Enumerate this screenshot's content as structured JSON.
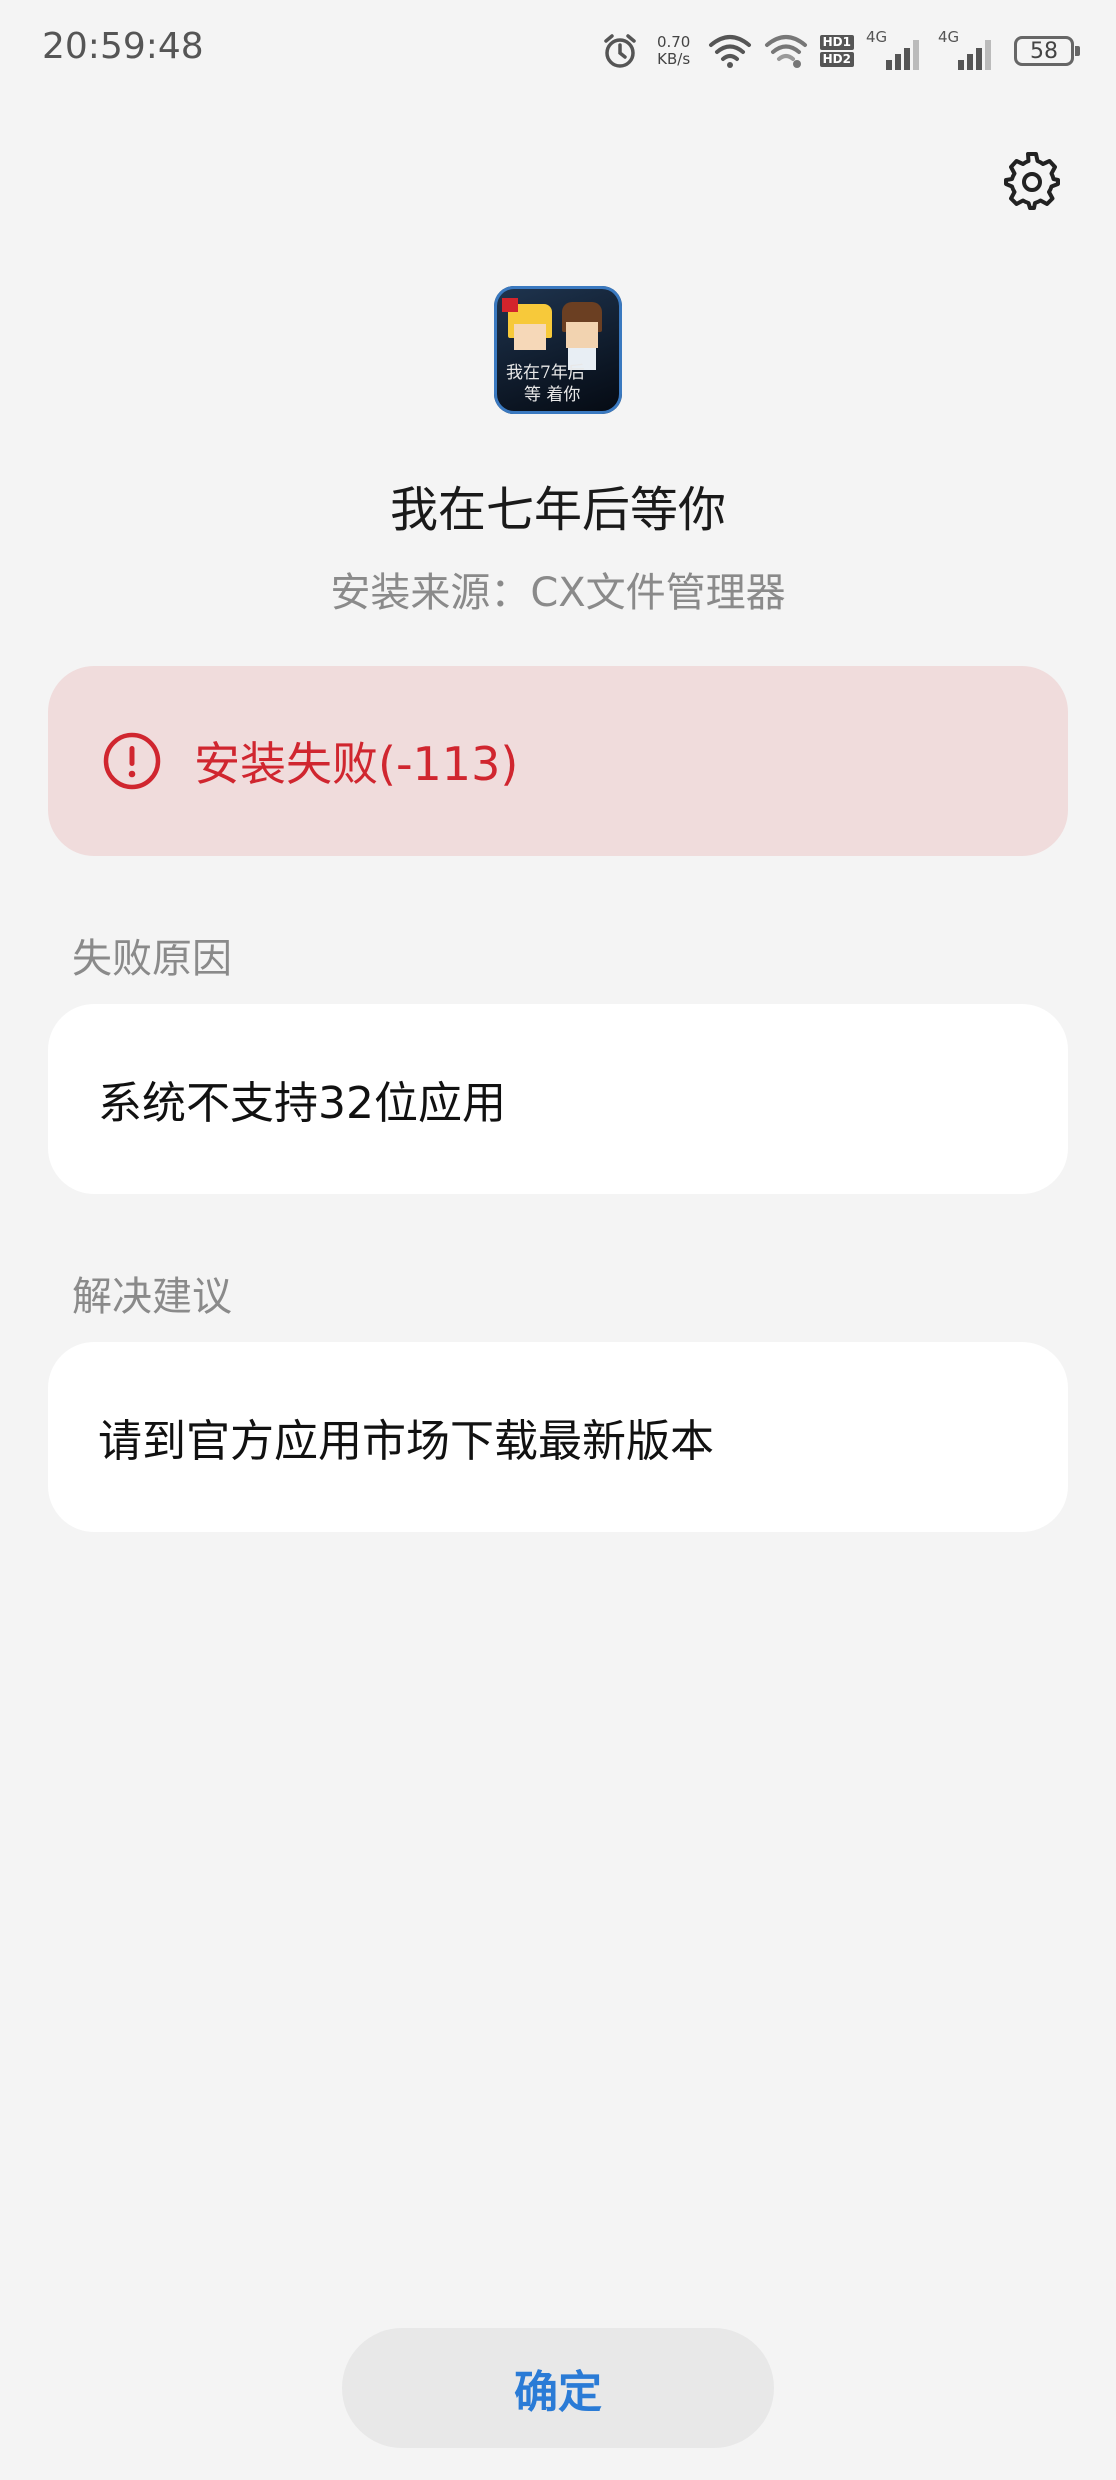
{
  "status_bar": {
    "time": "20:59:48",
    "net_speed_value": "0.70",
    "net_speed_unit": "KB/s",
    "hd1": "HD1",
    "hd2": "HD2",
    "sim1_tag": "4G",
    "sim2_tag": "4G",
    "battery": "58"
  },
  "header": {
    "settings_icon": "gear-icon"
  },
  "app": {
    "icon_text_line1": "我在7年后",
    "icon_text_line2": "等 着你",
    "name": "我在七年后等你",
    "install_source": "安装来源：CX文件管理器"
  },
  "error": {
    "icon": "alert-circle-icon",
    "message": "安装失败(-113)",
    "color": "#d0262f"
  },
  "failure_reason": {
    "label": "失败原因",
    "text": "系统不支持32位应用"
  },
  "suggestion": {
    "label": "解决建议",
    "text": "请到官方应用市场下载最新版本"
  },
  "footer": {
    "confirm_label": "确定",
    "accent": "#2a7bd6"
  }
}
